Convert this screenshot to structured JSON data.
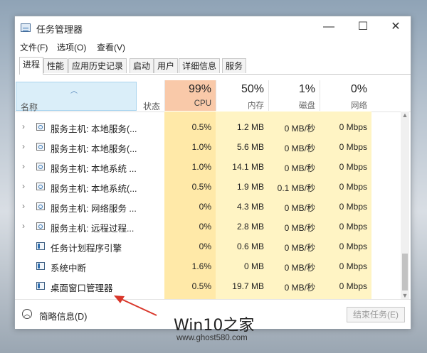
{
  "window": {
    "title": "任务管理器",
    "controls": {
      "minimize": "—",
      "maximize": "☐",
      "close": "✕"
    }
  },
  "menu": [
    {
      "label": "文件(F)"
    },
    {
      "label": "选项(O)"
    },
    {
      "label": "查看(V)"
    }
  ],
  "tabs": [
    {
      "label": "进程",
      "active": true
    },
    {
      "label": "性能"
    },
    {
      "label": "应用历史记录"
    },
    {
      "label": "启动"
    },
    {
      "label": "用户"
    },
    {
      "label": "详细信息"
    },
    {
      "label": "服务"
    }
  ],
  "columns": {
    "name": "名称",
    "status": "状态",
    "cpu": {
      "percent": "99%",
      "label": "CPU"
    },
    "memory": {
      "percent": "50%",
      "label": "内存"
    },
    "disk": {
      "percent": "1%",
      "label": "磁盘"
    },
    "network": {
      "percent": "0%",
      "label": "网络"
    }
  },
  "rows": [
    {
      "name": "服务主机: 本地服务(...",
      "expandable": true,
      "icon": "gear-icon",
      "cpu": "0.5%",
      "memory": "1.2 MB",
      "disk": "0 MB/秒",
      "network": "0 Mbps"
    },
    {
      "name": "服务主机: 本地服务(...",
      "expandable": true,
      "icon": "gear-icon",
      "cpu": "1.0%",
      "memory": "5.6 MB",
      "disk": "0 MB/秒",
      "network": "0 Mbps"
    },
    {
      "name": "服务主机: 本地系统 ...",
      "expandable": true,
      "icon": "gear-icon",
      "cpu": "1.0%",
      "memory": "14.1 MB",
      "disk": "0 MB/秒",
      "network": "0 Mbps"
    },
    {
      "name": "服务主机: 本地系统(...",
      "expandable": true,
      "icon": "gear-icon",
      "cpu": "0.5%",
      "memory": "1.9 MB",
      "disk": "0.1 MB/秒",
      "network": "0 Mbps"
    },
    {
      "name": "服务主机: 网络服务 ...",
      "expandable": true,
      "icon": "gear-icon",
      "cpu": "0%",
      "memory": "4.3 MB",
      "disk": "0 MB/秒",
      "network": "0 Mbps"
    },
    {
      "name": "服务主机: 远程过程...",
      "expandable": true,
      "icon": "gear-icon",
      "cpu": "0%",
      "memory": "2.8 MB",
      "disk": "0 MB/秒",
      "network": "0 Mbps"
    },
    {
      "name": "任务计划程序引擎",
      "expandable": false,
      "icon": "app-window-icon",
      "cpu": "0%",
      "memory": "0.6 MB",
      "disk": "0 MB/秒",
      "network": "0 Mbps"
    },
    {
      "name": "系统中断",
      "expandable": false,
      "icon": "app-window-icon",
      "cpu": "1.6%",
      "memory": "0 MB",
      "disk": "0 MB/秒",
      "network": "0 Mbps"
    },
    {
      "name": "桌面窗口管理器",
      "expandable": false,
      "icon": "app-window-icon",
      "cpu": "0.5%",
      "memory": "19.7 MB",
      "disk": "0 MB/秒",
      "network": "0 Mbps"
    }
  ],
  "footer": {
    "collapse_label": "简略信息(D)",
    "end_task_label": "结束任务(E)"
  },
  "watermark": {
    "title": "Win10之家",
    "url": "www.ghost580.com"
  },
  "colors": {
    "cpu_header_hot": "#f9c9a9",
    "cell_highlight_light": "#fff4c4",
    "cell_highlight_strong": "#ffe9a8",
    "selected_header": "#daeef9",
    "annotation_arrow": "#d9372b"
  }
}
